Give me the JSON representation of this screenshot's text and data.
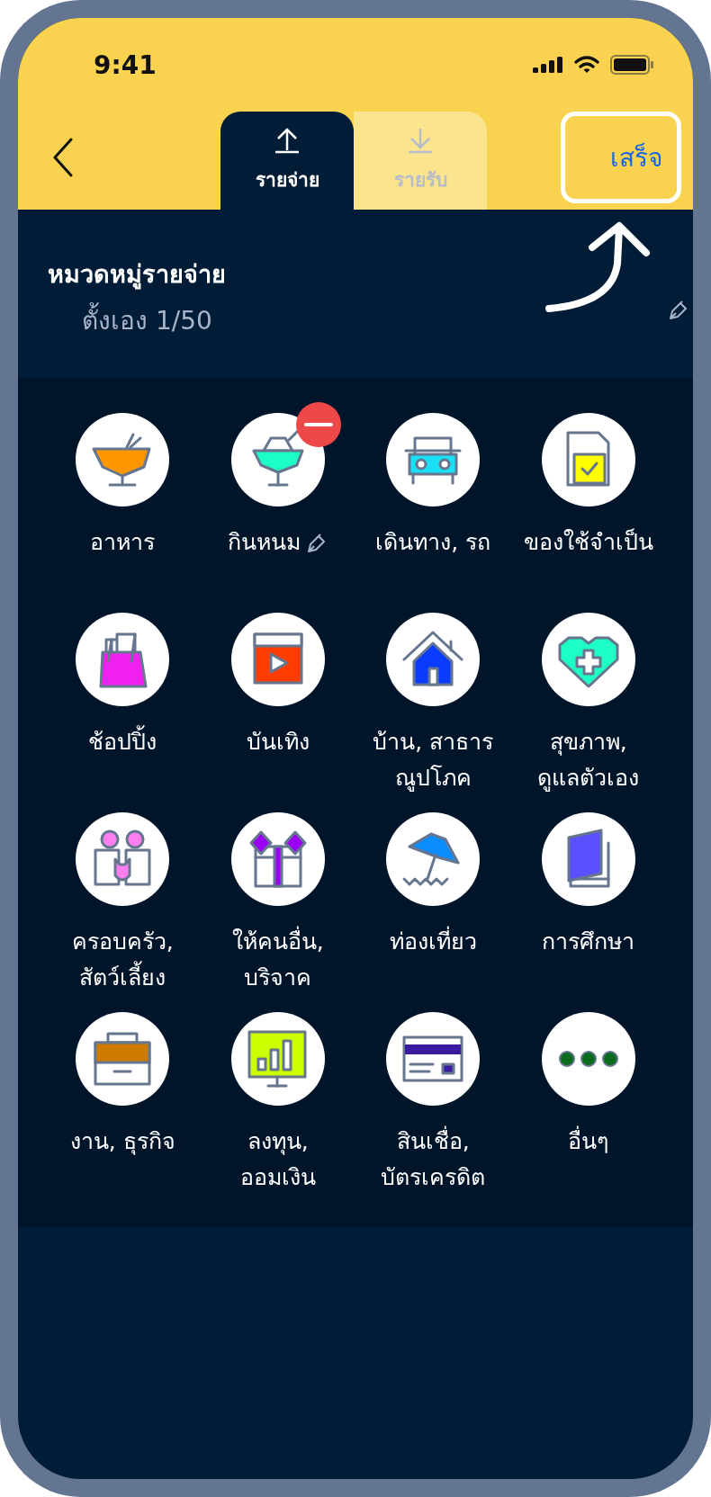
{
  "status_bar": {
    "time": "9:41"
  },
  "header": {
    "tabs": [
      {
        "label": "รายจ่าย",
        "kind": "upload",
        "selected": true
      },
      {
        "label": "รายรับ",
        "kind": "download",
        "selected": false
      }
    ],
    "done_button": "เสร็จ"
  },
  "section": {
    "title": "หมวดหมู่รายจ่าย",
    "subtitle": "ตั้งเอง 1/50"
  },
  "categories": [
    {
      "label": "อาหาร",
      "kind": "bowl",
      "color": "#ff9500",
      "removable": false,
      "editable": false
    },
    {
      "label": "กินหนม",
      "kind": "drink",
      "color": "#1dffc4",
      "removable": true,
      "editable": true
    },
    {
      "label": "เดินทาง, รถ",
      "kind": "car",
      "color": "#1ae0f5",
      "removable": false,
      "editable": false
    },
    {
      "label": "ของใช้จำเป็น",
      "kind": "document",
      "color": "#ffff00",
      "removable": false,
      "editable": false
    },
    {
      "label": "ช้อปปิ้ง",
      "kind": "bag",
      "color": "#f020f0",
      "removable": false,
      "editable": false
    },
    {
      "label": "บันเทิง",
      "kind": "video",
      "color": "#ff3d00",
      "removable": false,
      "editable": false
    },
    {
      "label": "บ้าน, สาธาร\nณูปโภค",
      "kind": "house",
      "color": "#0a3cff",
      "removable": false,
      "editable": false
    },
    {
      "label": "สุขภาพ,\nดูแลตัวเอง",
      "kind": "heart",
      "color": "#1dffc4",
      "removable": false,
      "editable": false
    },
    {
      "label": "ครอบครัว,\nสัตว์เลี้ยง",
      "kind": "family",
      "color": "#ff7ef0",
      "removable": false,
      "editable": false
    },
    {
      "label": "ให้คนอื่น,\nบริจาค",
      "kind": "gift",
      "color": "#9b00f5",
      "removable": false,
      "editable": false
    },
    {
      "label": "ท่องเที่ยว",
      "kind": "umbrella",
      "color": "#0a8cff",
      "removable": false,
      "editable": false
    },
    {
      "label": "การศึกษา",
      "kind": "book",
      "color": "#5a50ff",
      "removable": false,
      "editable": false
    },
    {
      "label": "งาน, ธุรกิจ",
      "kind": "briefcase",
      "color": "#cc7a00",
      "removable": false,
      "editable": false
    },
    {
      "label": "ลงทุน,\nออมเงิน",
      "kind": "chart",
      "color": "#ccff00",
      "removable": false,
      "editable": false
    },
    {
      "label": "สินเชื่อ,\nบัตรเครดิต",
      "kind": "card",
      "color": "#3a1a9e",
      "removable": false,
      "editable": false
    },
    {
      "label": "อื่นๆ",
      "kind": "dots",
      "color": "#0b6b1e",
      "removable": false,
      "editable": false
    }
  ]
}
